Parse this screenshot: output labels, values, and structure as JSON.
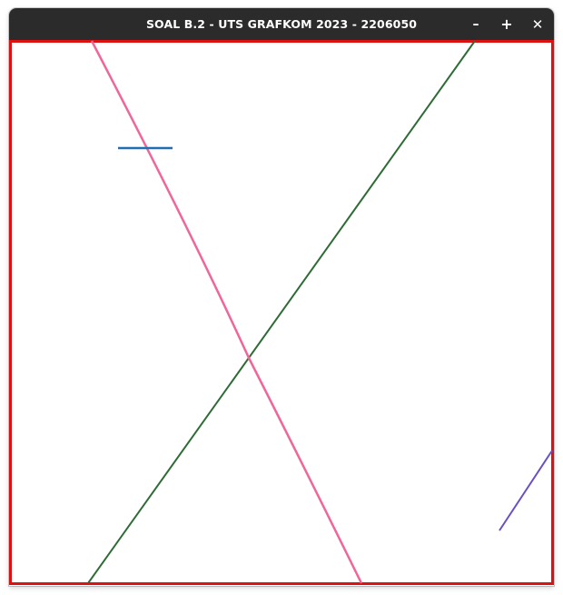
{
  "window": {
    "title": "SOAL B.2 - UTS GRAFKOM 2023 - 2206050",
    "controls": {
      "minimize_icon": "minimize-icon",
      "maximize_icon": "maximize-icon",
      "close_icon": "close-icon",
      "minimize_glyph": "–",
      "maximize_glyph": "+",
      "close_glyph": "✕"
    }
  },
  "canvas": {
    "background": "#ffffff",
    "colors": {
      "border": "#dd1111",
      "diagonal_line": "#2e6b35",
      "curve": "#f06699",
      "short_horizontal_line": "#1f6fb0",
      "short_diagonal_line": "#6a4fc7"
    }
  }
}
